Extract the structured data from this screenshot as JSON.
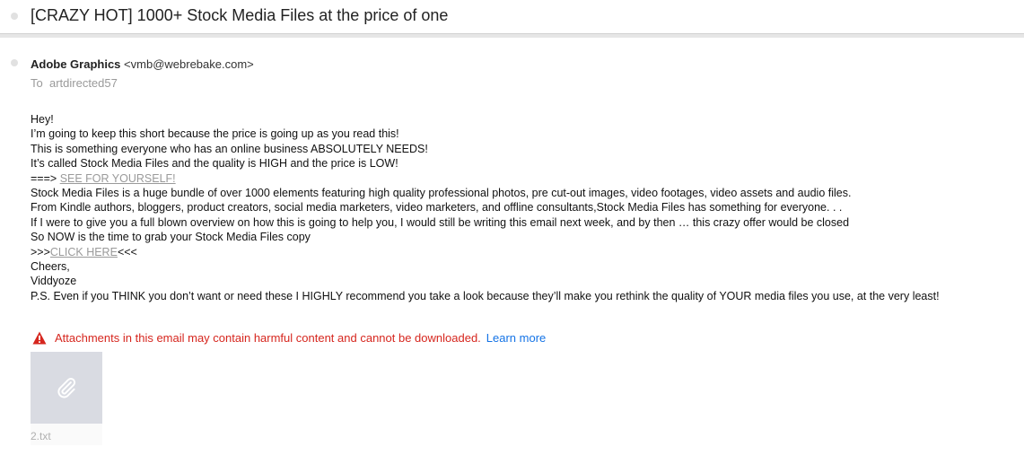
{
  "email": {
    "subject": "[CRAZY HOT] 1000+ Stock Media Files at the price of one",
    "from_name": "Adobe Graphics",
    "from_email": "<vmb@webrebake.com>",
    "to_label": "To",
    "to_value": "artdirected57"
  },
  "body": {
    "line1": "Hey!",
    "line2": "I’m going to keep this short because the price is going up as you read this!",
    "line3": "This is something everyone who has an online business ABSOLUTELY NEEDS!",
    "line4": "It’s called Stock Media Files and the quality is HIGH and the price is LOW!",
    "line5_prefix": "===> ",
    "line5_link": "SEE FOR YOURSELF!",
    "line6": "Stock Media Files is a huge bundle of over 1000 elements featuring high quality professional photos, pre cut-out images, video footages, video assets and audio files.",
    "line7": "From Kindle authors, bloggers, product creators, social media marketers, video marketers, and offline consultants,Stock Media Files has something for everyone. .  .",
    "line8": "If I were to give you a full blown overview on how this is going to help you, I would still be writing this email next week, and by then … this crazy offer would be closed",
    "line9": "So NOW is the time to grab your Stock Media Files copy",
    "line10_prefix": ">>>",
    "line10_link": "CLICK HERE",
    "line10_suffix": "<<<",
    "line11": "Cheers,",
    "line12": "Viddyoze",
    "line13": "P.S. Even if you THINK you don’t want or need these I HIGHLY recommend you take a look because they’ll make you rethink the quality of YOUR media files you use, at the very least!"
  },
  "warning": {
    "text": "Attachments in this email may contain harmful content and cannot be downloaded.",
    "learn_more": "Learn more",
    "color": "#d6261e",
    "link_color": "#1473e6"
  },
  "attachment": {
    "filename": "2.txt",
    "icon": "paperclip-icon"
  }
}
